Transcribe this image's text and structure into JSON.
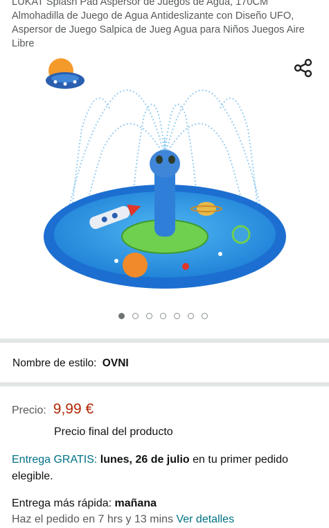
{
  "product": {
    "title": "LUKAT Splash Pad Aspersor de Juegos de Agua, 170CM Almohadilla de Juego de Agua Antideslizante con Diseño UFO, Aspersor de Juego Salpica de Jueg Agua para Niños Juegos Aire Libre"
  },
  "icons": {
    "share": "share-icon",
    "ufo_badge": "ufo-badge-icon"
  },
  "carousel": {
    "total": 7,
    "active_index": 0
  },
  "style": {
    "label": "Nombre de estilo:",
    "value": "OVNI"
  },
  "price": {
    "label": "Precio:",
    "value": "9,99 €",
    "note": "Precio final del producto"
  },
  "delivery": {
    "prefix": "Entrega GRATIS:",
    "date": "lunes, 26 de julio",
    "suffix": " en tu primer pedido elegible."
  },
  "fast_delivery": {
    "label": "Entrega más rápida:",
    "value": "mañana",
    "order_in": "Haz el pedido en 7 hrs y 13 mins",
    "details_link": "Ver detalles"
  },
  "colors": {
    "price": "#b12704",
    "link": "#007185",
    "separator": "#e3e6e6"
  }
}
